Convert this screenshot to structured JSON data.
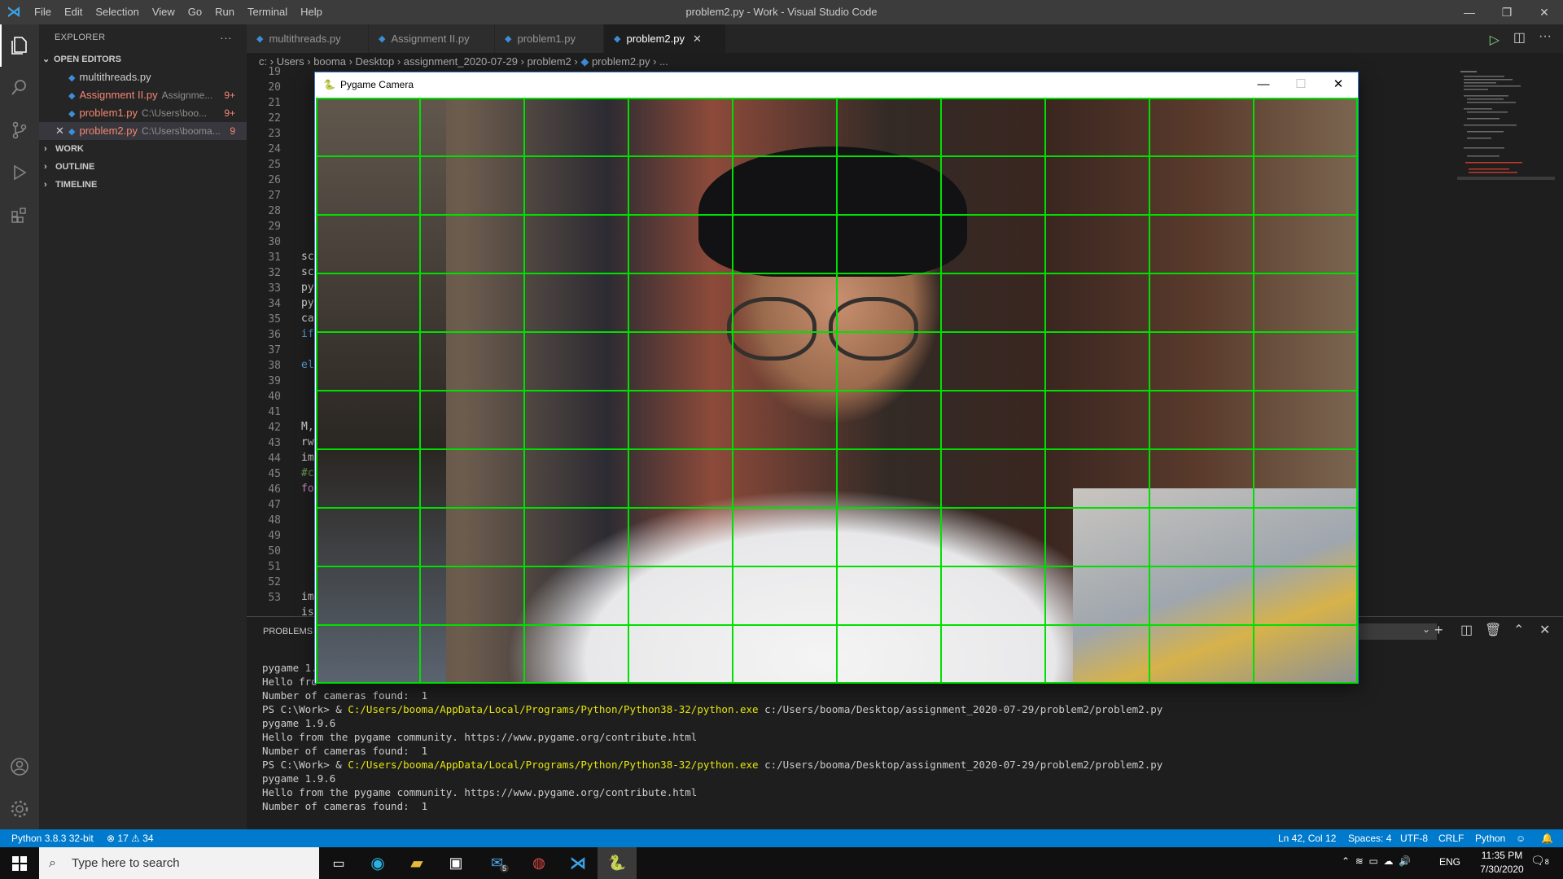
{
  "window": {
    "title": "problem2.py - Work - Visual Studio Code"
  },
  "menu": [
    "File",
    "Edit",
    "Selection",
    "View",
    "Go",
    "Run",
    "Terminal",
    "Help"
  ],
  "sidebar": {
    "title": "EXPLORER",
    "more": "···",
    "open_editors_label": "OPEN EDITORS",
    "open_editors": [
      {
        "name": "multithreads.py",
        "path": "",
        "count": ""
      },
      {
        "name": "Assignment II.py",
        "path": "Assignme...",
        "count": "9+"
      },
      {
        "name": "problem1.py",
        "path": "C:\\Users\\boo...",
        "count": "9+"
      },
      {
        "name": "problem2.py",
        "path": "C:\\Users\\booma...",
        "count": "9"
      }
    ],
    "sections": [
      "WORK",
      "OUTLINE",
      "TIMELINE"
    ]
  },
  "tabs": [
    {
      "label": "multithreads.py"
    },
    {
      "label": "Assignment II.py"
    },
    {
      "label": "problem1.py"
    },
    {
      "label": "problem2.py",
      "close": "✕"
    }
  ],
  "breadcrumb": [
    "c:",
    "Users",
    "booma",
    "Desktop",
    "assignment_2020-07-29",
    "problem2",
    "problem2.py",
    "..."
  ],
  "editor": {
    "line_numbers": [
      "19",
      "20",
      "21",
      "22",
      "23",
      "24",
      "25",
      "26",
      "27",
      "28",
      "29",
      "30",
      "31",
      "32",
      "33",
      "34",
      "35",
      "36",
      "37",
      "38",
      "39",
      "40",
      "41",
      "42",
      "43",
      "44",
      "45",
      "46",
      "47",
      "48",
      "49",
      "50",
      "51",
      "52",
      "53",
      "54"
    ],
    "visible_code": {
      "31": "sc",
      "32": "sc",
      "33": "py",
      "34": "py",
      "35": "ca",
      "36": "if",
      "38": "el",
      "42": "M,",
      "43": "rw",
      "44": "im",
      "45": "#c",
      "46": "fo",
      "53": "im",
      "54": "is"
    }
  },
  "panel": {
    "tab": "PROBLEMS",
    "lines": [
      {
        "text": "pygame 1."
      },
      {
        "text": "Hello fro"
      },
      {
        "text": "Number of cameras found:  1"
      },
      {
        "prompt": "PS C:\\Work> & ",
        "exe": "C:/Users/booma/AppData/Local/Programs/Python/Python38-32/python.exe",
        "arg": " c:/Users/booma/Desktop/assignment_2020-07-29/problem2/problem2.py"
      },
      {
        "text": "pygame 1.9.6"
      },
      {
        "text": "Hello from the pygame community. https://www.pygame.org/contribute.html"
      },
      {
        "text": "Number of cameras found:  1"
      },
      {
        "prompt": "PS C:\\Work> & ",
        "exe": "C:/Users/booma/AppData/Local/Programs/Python/Python38-32/python.exe",
        "arg": " c:/Users/booma/Desktop/assignment_2020-07-29/problem2/problem2.py"
      },
      {
        "text": "pygame 1.9.6"
      },
      {
        "text": "Hello from the pygame community. https://www.pygame.org/contribute.html"
      },
      {
        "text": "Number of cameras found:  1"
      }
    ]
  },
  "pygame_window": {
    "title": "Pygame Camera",
    "grid_color": "#00e000",
    "grid_cols": 10,
    "grid_rows": 10
  },
  "status": {
    "interpreter": "Python 3.8.3 32-bit",
    "errors": "17",
    "warnings": "34",
    "position": "Ln 42, Col 12",
    "spaces": "Spaces: 4",
    "encoding": "UTF-8",
    "eol": "CRLF",
    "language": "Python"
  },
  "taskbar": {
    "search_placeholder": "Type here to search",
    "mail_badge": "5",
    "time": "11:35 PM",
    "date": "7/30/2020",
    "lang": "ENG",
    "notif_badge": "8"
  },
  "colors": {
    "accent": "#007acc",
    "grid": "#00e000",
    "error": "#f48771"
  }
}
